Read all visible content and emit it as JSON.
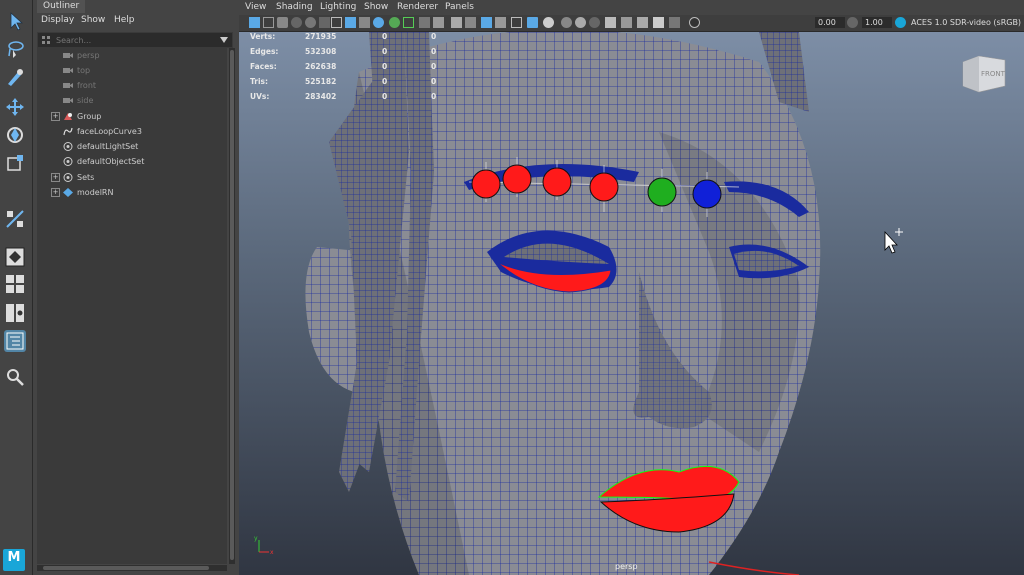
{
  "outliner": {
    "tab": "Outliner",
    "menu": [
      "Display",
      "Show",
      "Help"
    ],
    "search_placeholder": "Search...",
    "items": [
      {
        "label": "persp",
        "icon": "camera-icon",
        "dim": true,
        "expandable": false
      },
      {
        "label": "top",
        "icon": "camera-icon",
        "dim": true,
        "expandable": false
      },
      {
        "label": "front",
        "icon": "camera-icon",
        "dim": true,
        "expandable": false
      },
      {
        "label": "side",
        "icon": "camera-icon",
        "dim": true,
        "expandable": false
      },
      {
        "label": "Group",
        "icon": "group-icon",
        "dim": false,
        "expandable": true
      },
      {
        "label": "faceLoopCurve3",
        "icon": "curve-icon",
        "dim": false,
        "expandable": false
      },
      {
        "label": "defaultLightSet",
        "icon": "set-icon",
        "dim": false,
        "expandable": false
      },
      {
        "label": "defaultObjectSet",
        "icon": "set-icon",
        "dim": false,
        "expandable": false
      },
      {
        "label": "Sets",
        "icon": "set-icon",
        "dim": false,
        "expandable": true
      },
      {
        "label": "modelRN",
        "icon": "reference-icon",
        "dim": false,
        "expandable": true
      }
    ]
  },
  "viewport": {
    "menu": [
      "View",
      "Shading",
      "Lighting",
      "Show",
      "Renderer",
      "Panels"
    ],
    "exposure": "0.00",
    "gamma": "1.00",
    "color_space": "ACES 1.0 SDR-video (sRGB)",
    "camera_label": "persp",
    "viewcube_label": "FRONT",
    "hud": [
      {
        "label": "Verts:",
        "value": "271935",
        "a": "0",
        "b": "0"
      },
      {
        "label": "Edges:",
        "value": "532308",
        "a": "0",
        "b": "0"
      },
      {
        "label": "Faces:",
        "value": "262638",
        "a": "0",
        "b": "0"
      },
      {
        "label": "Tris:",
        "value": "525182",
        "a": "0",
        "b": "0"
      },
      {
        "label": "UVs:",
        "value": "283402",
        "a": "0",
        "b": "0"
      }
    ]
  },
  "colors": {
    "wire": "#1a2b9e",
    "skin": "#8a8c94",
    "selection_red": "#ff1a1a",
    "control_green": "#1fae1f",
    "control_blue": "#1020d8"
  },
  "brand_badge": "M"
}
